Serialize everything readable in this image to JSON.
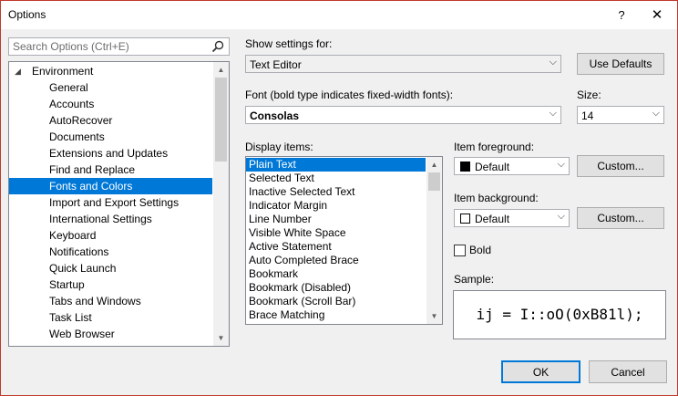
{
  "window": {
    "title": "Options",
    "help_glyph": "?",
    "close_glyph": "✕"
  },
  "search": {
    "placeholder": "Search Options (Ctrl+E)"
  },
  "tree": {
    "parent": "Environment",
    "items": [
      "General",
      "Accounts",
      "AutoRecover",
      "Documents",
      "Extensions and Updates",
      "Find and Replace",
      "Fonts and Colors",
      "Import and Export Settings",
      "International Settings",
      "Keyboard",
      "Notifications",
      "Quick Launch",
      "Startup",
      "Tabs and Windows",
      "Task List",
      "Web Browser"
    ],
    "selected": "Fonts and Colors"
  },
  "settings": {
    "show_settings_label": "Show settings for:",
    "show_settings_value": "Text Editor",
    "use_defaults_label": "Use Defaults",
    "font_label": "Font (bold type indicates fixed-width fonts):",
    "font_value": "Consolas",
    "size_label": "Size:",
    "size_value": "14"
  },
  "display_items": {
    "label": "Display items:",
    "items": [
      "Plain Text",
      "Selected Text",
      "Inactive Selected Text",
      "Indicator Margin",
      "Line Number",
      "Visible White Space",
      "Active Statement",
      "Auto Completed Brace",
      "Bookmark",
      "Bookmark (Disabled)",
      "Bookmark (Scroll Bar)",
      "Brace Matching"
    ],
    "selected": "Plain Text"
  },
  "foreground": {
    "label": "Item foreground:",
    "value": "Default",
    "swatch_color": "#000000",
    "custom_label": "Custom..."
  },
  "background": {
    "label": "Item background:",
    "value": "Default",
    "swatch_color": "#ffffff",
    "custom_label": "Custom..."
  },
  "bold": {
    "label": "Bold",
    "checked": false
  },
  "sample": {
    "label": "Sample:",
    "text": "ij = I::oO(0xB81l);"
  },
  "footer": {
    "ok_label": "OK",
    "cancel_label": "Cancel"
  },
  "colors": {
    "accent": "#0078d7",
    "window_border": "#c0392b"
  }
}
